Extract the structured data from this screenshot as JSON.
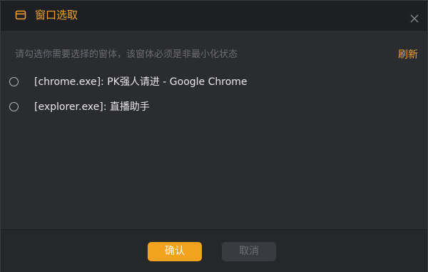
{
  "dialog": {
    "title": "窗口选取",
    "title_icon": "window-icon",
    "close_icon": "close-icon",
    "accent_color": "#f0a32c"
  },
  "content": {
    "hint": "请勾选你需要选择的窗体，该窗体必须是非最小化状态",
    "refresh_label": "刷新",
    "options": [
      {
        "label": "[chrome.exe]: PK强人请进 - Google Chrome",
        "selected": false
      },
      {
        "label": "[explorer.exe]: 直播助手",
        "selected": false
      }
    ]
  },
  "footer": {
    "confirm_label": "确认",
    "cancel_label": "取消"
  }
}
